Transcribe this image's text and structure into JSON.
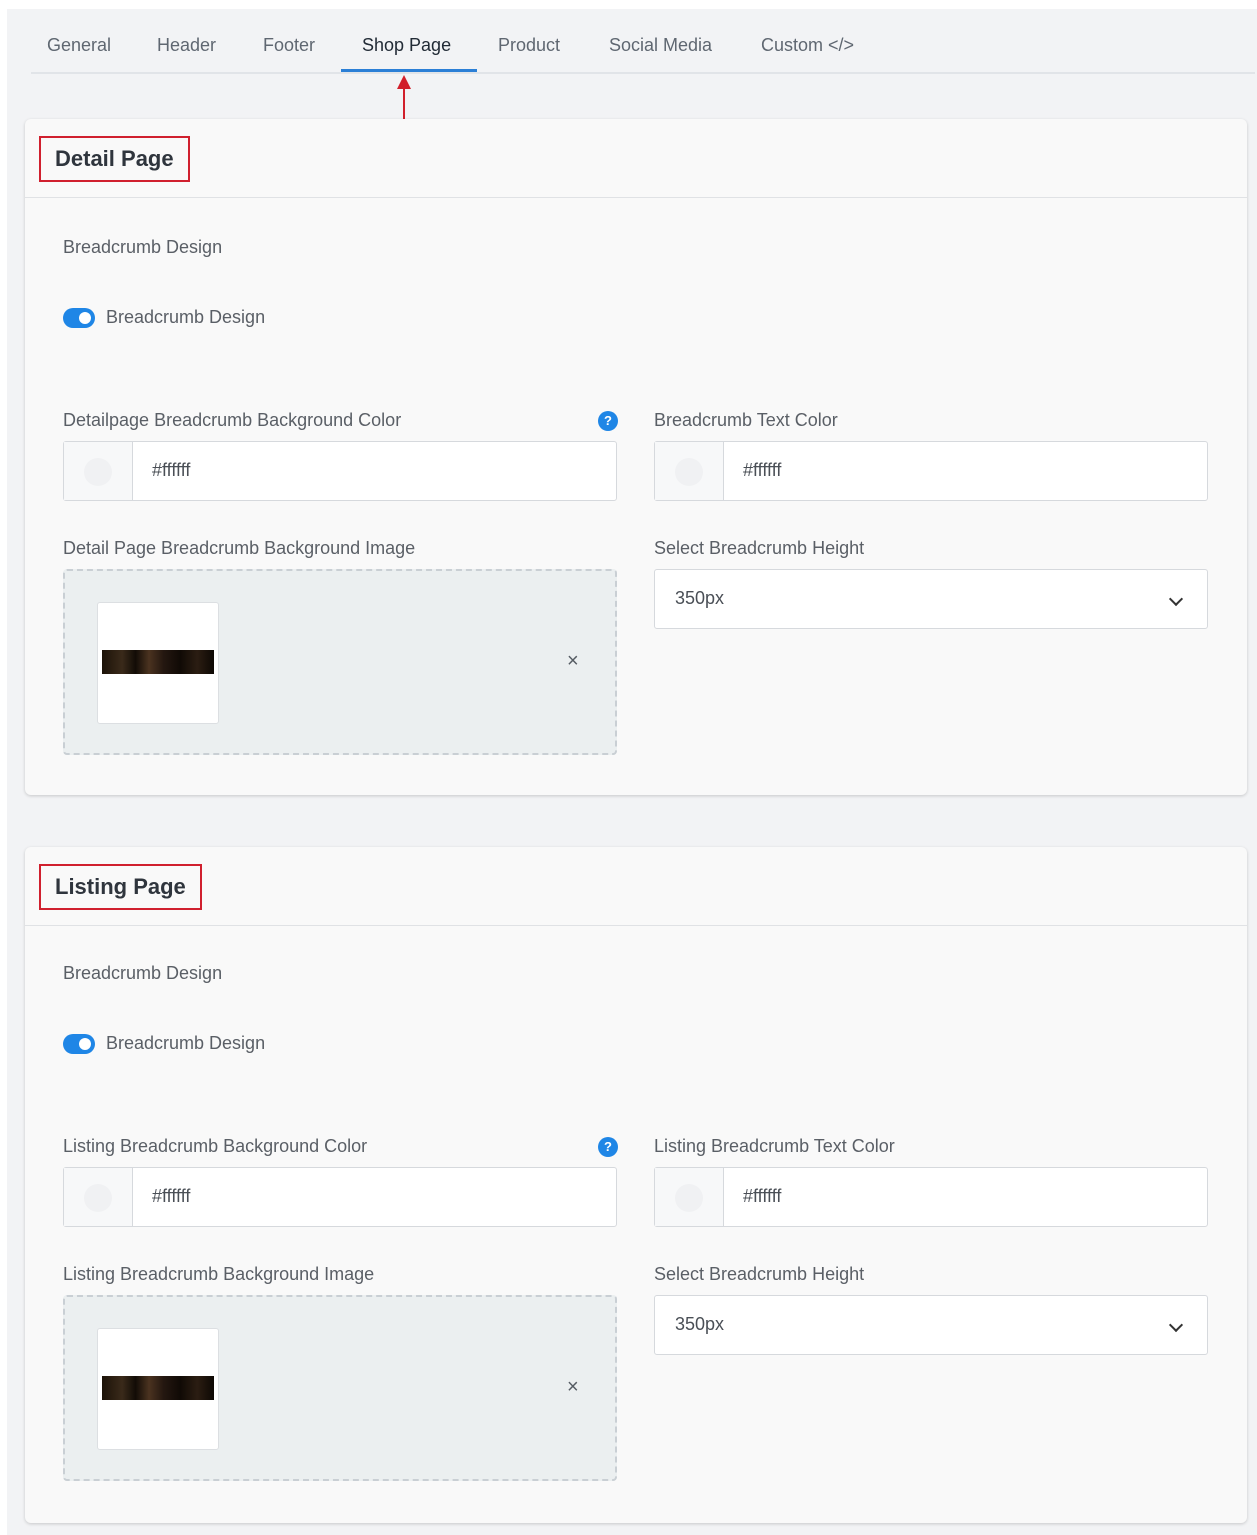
{
  "tabs": [
    {
      "label": "General"
    },
    {
      "label": "Header"
    },
    {
      "label": "Footer"
    },
    {
      "label": "Shop Page"
    },
    {
      "label": "Product"
    },
    {
      "label": "Social Media"
    },
    {
      "label": "Custom </>"
    }
  ],
  "active_tab": "Shop Page",
  "detail": {
    "title": "Detail Page",
    "section_label": "Breadcrumb Design",
    "toggle_label": "Breadcrumb Design",
    "toggle_on": true,
    "bg_color_label": "Detailpage Breadcrumb Background Color",
    "bg_color_value": "#ffffff",
    "text_color_label": "Breadcrumb Text Color",
    "text_color_value": "#ffffff",
    "bg_image_label": "Detail Page Breadcrumb Background Image",
    "remove_icon": "×",
    "height_label": "Select Breadcrumb Height",
    "height_value": "350px"
  },
  "listing": {
    "title": "Listing Page",
    "section_label": "Breadcrumb Design",
    "toggle_label": "Breadcrumb Design",
    "toggle_on": true,
    "bg_color_label": "Listing Breadcrumb Background Color",
    "bg_color_value": "#ffffff",
    "text_color_label": "Listing Breadcrumb Text Color",
    "text_color_value": "#ffffff",
    "bg_image_label": "Listing Breadcrumb Background Image",
    "remove_icon": "×",
    "height_label": "Select Breadcrumb Height",
    "height_value": "350px"
  },
  "help_icon_glyph": "?",
  "colors": {
    "accent": "#1f86e6",
    "highlight_box": "#d0202e",
    "tab_underline": "#2b7fd6"
  }
}
